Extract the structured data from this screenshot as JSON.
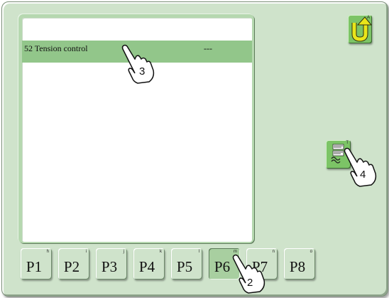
{
  "list": {
    "rows": [
      {
        "name": "52 Tension control",
        "value": "---"
      }
    ]
  },
  "tabs": [
    {
      "label": "P1",
      "key": "h",
      "selected": false
    },
    {
      "label": "P2",
      "key": "i",
      "selected": false
    },
    {
      "label": "P3",
      "key": "j",
      "selected": false
    },
    {
      "label": "P4",
      "key": "k",
      "selected": false
    },
    {
      "label": "P5",
      "key": "l",
      "selected": false
    },
    {
      "label": "P6",
      "key": "m",
      "selected": true
    },
    {
      "label": "P7",
      "key": "n",
      "selected": false
    },
    {
      "label": "P8",
      "key": "o",
      "selected": false
    }
  ],
  "buttons": {
    "back": {
      "key": "A",
      "icon": "u-turn-arrow-icon"
    },
    "tension": {
      "key": "T",
      "icon": "tension-settings-icon"
    }
  },
  "callouts": {
    "row": "3",
    "tab": "2",
    "button": "4"
  },
  "colors": {
    "background": "#cfe3cb",
    "selected_row": "#92c68a",
    "button_green": "#7cc466",
    "arrow_yellow": "#e8e51a"
  }
}
